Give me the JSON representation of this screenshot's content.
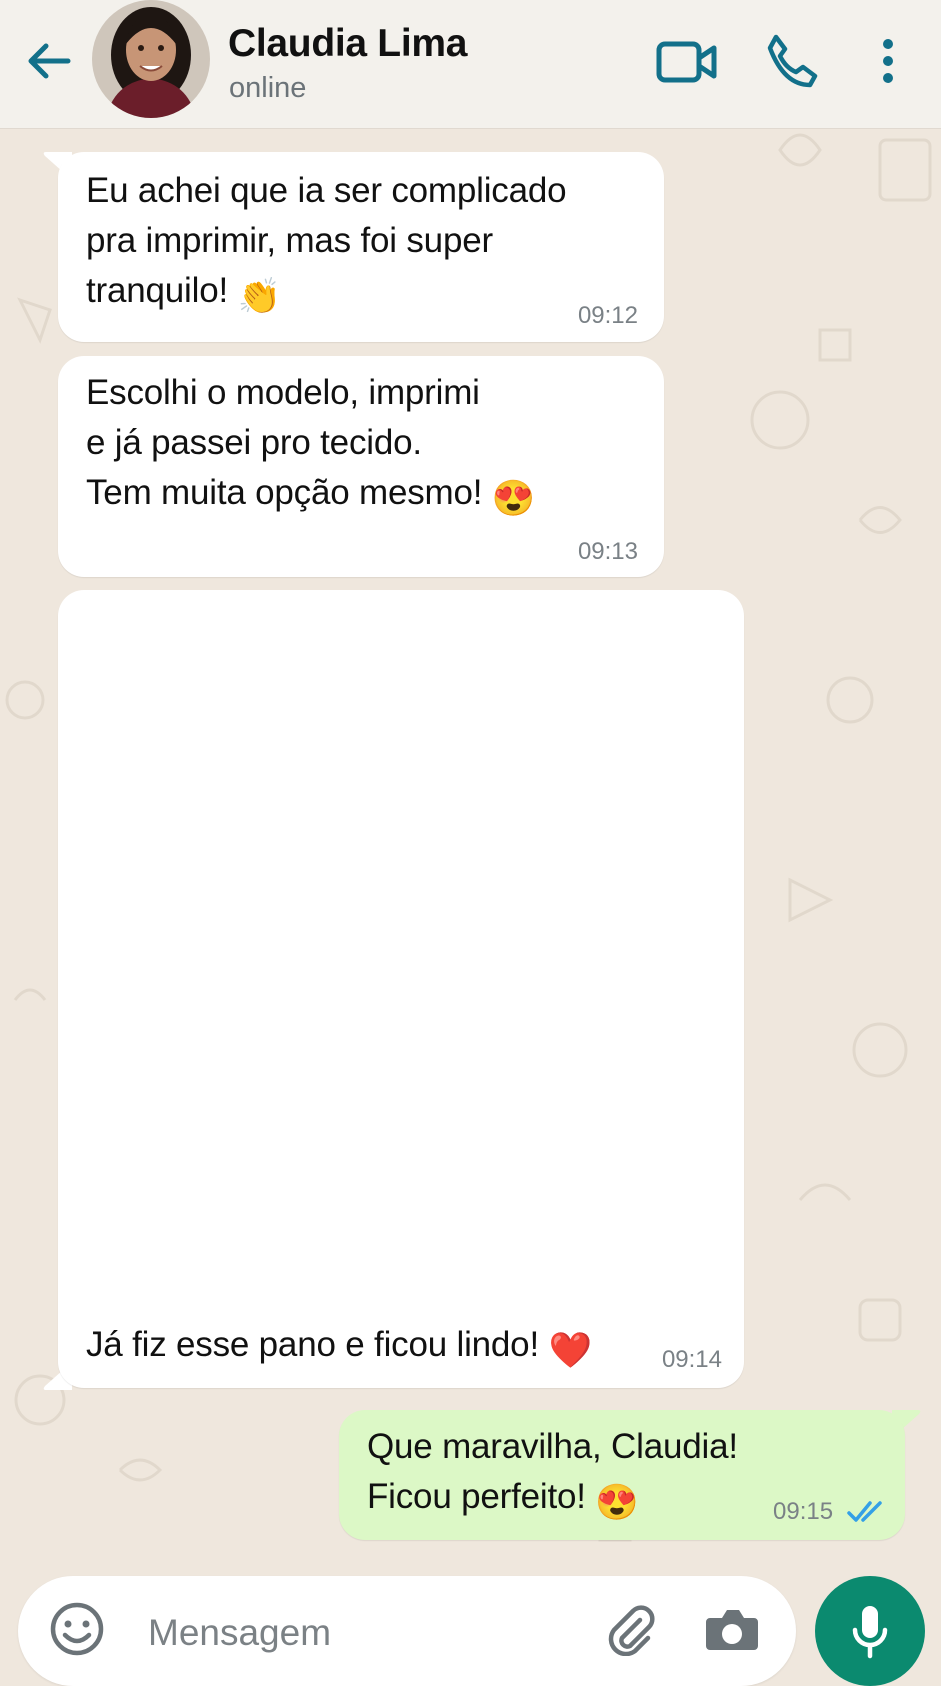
{
  "header": {
    "contact_name": "Claudia Lima",
    "status": "online",
    "icons": [
      "back-arrow-icon",
      "video-call-icon",
      "phone-icon",
      "more-vert-icon"
    ]
  },
  "messages": [
    {
      "direction": "in",
      "text": "Eu achei que ia ser complicado\npra imprimir, mas foi super\ntranquilo!",
      "emoji": "👏",
      "time": "09:12"
    },
    {
      "direction": "in",
      "text": "Escolhi o modelo, imprimi\ne já passei pro tecido.\nTem muita opção mesmo!",
      "emoji": "😍",
      "time": "09:13"
    },
    {
      "direction": "in",
      "type": "image",
      "caption": "Já fiz esse pano e ficou lindo!",
      "emoji": "❤️",
      "time": "09:14"
    },
    {
      "direction": "out",
      "text": "Que maravilha, Claudia!\nFicou perfeito!",
      "emoji": "😍",
      "time": "09:15",
      "read": true
    }
  ],
  "composer": {
    "placeholder": "Mensagem",
    "icons": [
      "emoji-icon",
      "attach-icon",
      "camera-icon",
      "mic-icon"
    ]
  },
  "colors": {
    "accent": "#0b8a6f",
    "icon": "#12708a",
    "outgoing_bubble": "#dcf8c6",
    "incoming_bubble": "#ffffff",
    "read_ticks": "#34a0e6"
  }
}
